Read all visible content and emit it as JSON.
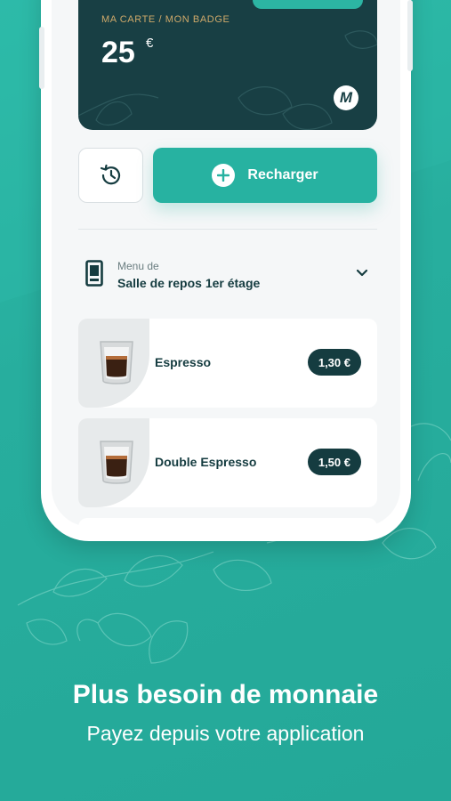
{
  "card": {
    "label": "MA CARTE / MON BADGE",
    "amount": "25",
    "currency": "€",
    "logo": "M"
  },
  "actions": {
    "history_icon": "history-icon",
    "recharge_label": "Recharger"
  },
  "menu": {
    "prefix": "Menu de",
    "location": "Salle de repos 1er étage"
  },
  "products": [
    {
      "name": "Espresso",
      "price": "1,30 €"
    },
    {
      "name": "Double Espresso",
      "price": "1,50 €"
    }
  ],
  "promo": {
    "headline": "Plus besoin de monnaie",
    "subline": "Payez depuis votre application"
  },
  "colors": {
    "accent": "#27b2a1",
    "dark": "#153c40",
    "card_bg": "#183f44",
    "gold": "#cfa96a"
  }
}
